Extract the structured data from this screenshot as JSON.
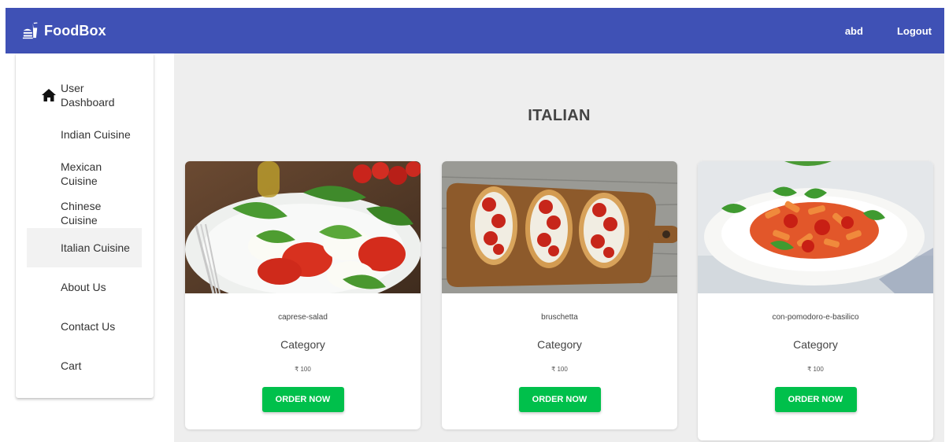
{
  "app": {
    "brand": "FoodBox",
    "brand_icon": "fastfood-icon"
  },
  "header": {
    "user": "abd",
    "logout": "Logout"
  },
  "sidebar": {
    "items": [
      {
        "label": "User Dashboard",
        "icon": "home-icon",
        "active": false
      },
      {
        "label": "Indian Cuisine",
        "active": false
      },
      {
        "label": "Mexican Cuisine",
        "active": false
      },
      {
        "label": "Chinese Cuisine",
        "active": false
      },
      {
        "label": "Italian Cuisine",
        "active": true
      },
      {
        "label": "About Us",
        "active": false
      },
      {
        "label": "Contact Us",
        "active": false
      },
      {
        "label": "Cart",
        "active": false
      }
    ]
  },
  "main": {
    "title": "ITALIAN",
    "cards": [
      {
        "name": "caprese-salad",
        "category": "Category",
        "price": "₹ 100",
        "button": "ORDER NOW"
      },
      {
        "name": "bruschetta",
        "category": "Category",
        "price": "₹ 100",
        "button": "ORDER NOW"
      },
      {
        "name": "con-pomodoro-e-basilico",
        "category": "Category",
        "price": "₹ 100",
        "button": "ORDER NOW"
      }
    ]
  },
  "colors": {
    "appbar": "#3f51b5",
    "order_button": "#00c04b",
    "content_bg": "#eeeeee"
  }
}
